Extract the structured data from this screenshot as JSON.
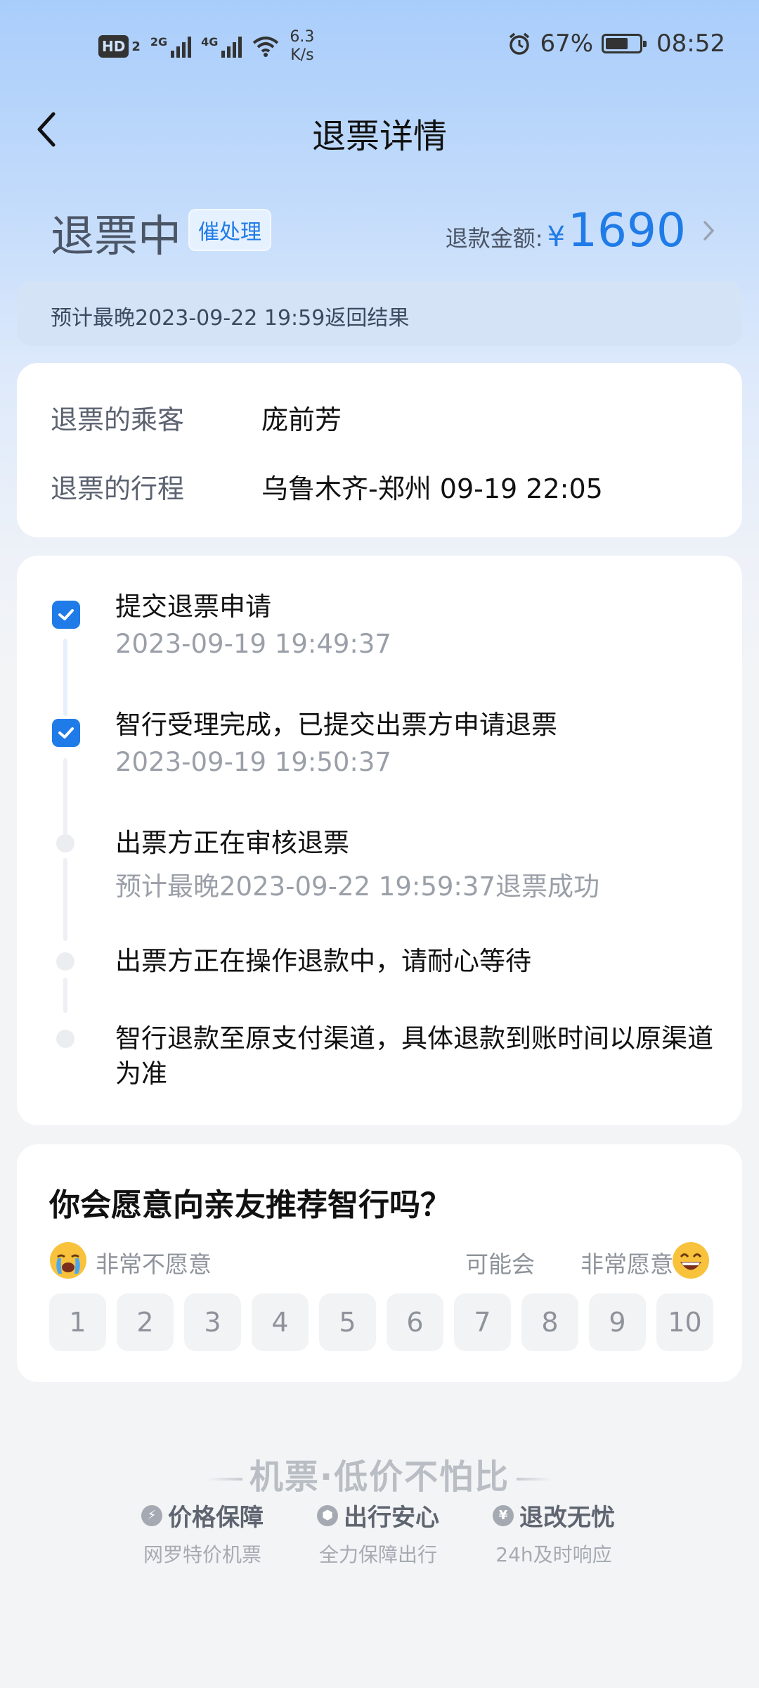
{
  "status_bar": {
    "hd_label": "HD",
    "sim2_label": "2",
    "net1_label": "2G",
    "net2_label": "4G",
    "speed_value": "6.3",
    "speed_unit": "K/s",
    "battery_percent": "67%",
    "time": "08:52"
  },
  "header": {
    "title": "退票详情"
  },
  "refund": {
    "status": "退票中",
    "urge_label": "催处理",
    "amount_label": "退款金额:",
    "currency": "¥",
    "amount": "1690"
  },
  "notice": "预计最晚2023-09-22 19:59返回结果",
  "trip_info": {
    "passenger_label": "退票的乘客",
    "passenger_value": "庞前芳",
    "itinerary_label": "退票的行程",
    "itinerary_value": "乌鲁木齐-郑州 09-19 22:05"
  },
  "progress": [
    {
      "title": "提交退票申请",
      "subtitle": "2023-09-19 19:49:37",
      "done": true
    },
    {
      "title": "智行受理完成，已提交出票方申请退票",
      "subtitle": "2023-09-19 19:50:37",
      "done": true
    },
    {
      "title": "出票方正在审核退票",
      "subtitle": "预计最晚2023-09-22 19:59:37退票成功",
      "done": false
    },
    {
      "title": "出票方正在操作退款中，请耐心等待",
      "subtitle": "",
      "done": false
    },
    {
      "title": "智行退款至原支付渠道，具体退款到账时间以原渠道为准",
      "subtitle": "",
      "done": false
    }
  ],
  "survey": {
    "question": "你会愿意向亲友推荐智行吗？",
    "low_label": "非常不愿意",
    "mid_label": "可能会",
    "high_label": "非常愿意",
    "scores": [
      "1",
      "2",
      "3",
      "4",
      "5",
      "6",
      "7",
      "8",
      "9",
      "10"
    ]
  },
  "promo": {
    "slogan": "机票·低价不怕比",
    "features": [
      {
        "icon": "lightning-shield-icon",
        "title": "价格保障",
        "subtitle": "网罗特价机票"
      },
      {
        "icon": "shield-icon",
        "title": "出行安心",
        "subtitle": "全力保障出行"
      },
      {
        "icon": "yen-shield-icon",
        "title": "退改无忧",
        "subtitle": "24h及时响应"
      }
    ]
  },
  "colors": {
    "accent": "#1f7be7",
    "bg_top": "#a9cdfb",
    "card": "#ffffff"
  }
}
